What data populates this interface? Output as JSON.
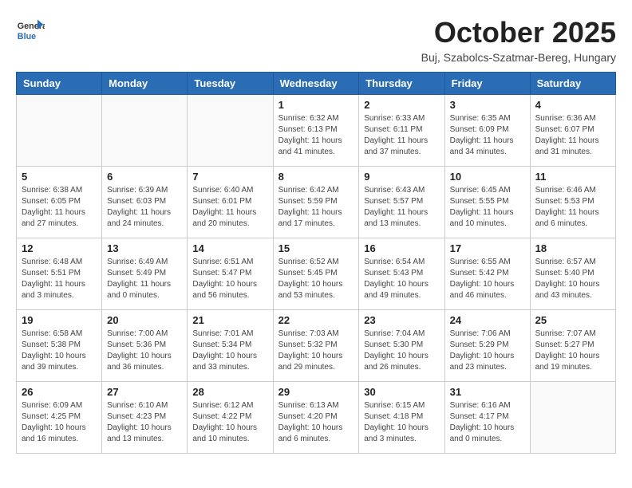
{
  "header": {
    "logo_line1": "General",
    "logo_line2": "Blue",
    "month": "October 2025",
    "location": "Buj, Szabolcs-Szatmar-Bereg, Hungary"
  },
  "weekdays": [
    "Sunday",
    "Monday",
    "Tuesday",
    "Wednesday",
    "Thursday",
    "Friday",
    "Saturday"
  ],
  "weeks": [
    [
      {
        "day": "",
        "info": ""
      },
      {
        "day": "",
        "info": ""
      },
      {
        "day": "",
        "info": ""
      },
      {
        "day": "1",
        "info": "Sunrise: 6:32 AM\nSunset: 6:13 PM\nDaylight: 11 hours\nand 41 minutes."
      },
      {
        "day": "2",
        "info": "Sunrise: 6:33 AM\nSunset: 6:11 PM\nDaylight: 11 hours\nand 37 minutes."
      },
      {
        "day": "3",
        "info": "Sunrise: 6:35 AM\nSunset: 6:09 PM\nDaylight: 11 hours\nand 34 minutes."
      },
      {
        "day": "4",
        "info": "Sunrise: 6:36 AM\nSunset: 6:07 PM\nDaylight: 11 hours\nand 31 minutes."
      }
    ],
    [
      {
        "day": "5",
        "info": "Sunrise: 6:38 AM\nSunset: 6:05 PM\nDaylight: 11 hours\nand 27 minutes."
      },
      {
        "day": "6",
        "info": "Sunrise: 6:39 AM\nSunset: 6:03 PM\nDaylight: 11 hours\nand 24 minutes."
      },
      {
        "day": "7",
        "info": "Sunrise: 6:40 AM\nSunset: 6:01 PM\nDaylight: 11 hours\nand 20 minutes."
      },
      {
        "day": "8",
        "info": "Sunrise: 6:42 AM\nSunset: 5:59 PM\nDaylight: 11 hours\nand 17 minutes."
      },
      {
        "day": "9",
        "info": "Sunrise: 6:43 AM\nSunset: 5:57 PM\nDaylight: 11 hours\nand 13 minutes."
      },
      {
        "day": "10",
        "info": "Sunrise: 6:45 AM\nSunset: 5:55 PM\nDaylight: 11 hours\nand 10 minutes."
      },
      {
        "day": "11",
        "info": "Sunrise: 6:46 AM\nSunset: 5:53 PM\nDaylight: 11 hours\nand 6 minutes."
      }
    ],
    [
      {
        "day": "12",
        "info": "Sunrise: 6:48 AM\nSunset: 5:51 PM\nDaylight: 11 hours\nand 3 minutes."
      },
      {
        "day": "13",
        "info": "Sunrise: 6:49 AM\nSunset: 5:49 PM\nDaylight: 11 hours\nand 0 minutes."
      },
      {
        "day": "14",
        "info": "Sunrise: 6:51 AM\nSunset: 5:47 PM\nDaylight: 10 hours\nand 56 minutes."
      },
      {
        "day": "15",
        "info": "Sunrise: 6:52 AM\nSunset: 5:45 PM\nDaylight: 10 hours\nand 53 minutes."
      },
      {
        "day": "16",
        "info": "Sunrise: 6:54 AM\nSunset: 5:43 PM\nDaylight: 10 hours\nand 49 minutes."
      },
      {
        "day": "17",
        "info": "Sunrise: 6:55 AM\nSunset: 5:42 PM\nDaylight: 10 hours\nand 46 minutes."
      },
      {
        "day": "18",
        "info": "Sunrise: 6:57 AM\nSunset: 5:40 PM\nDaylight: 10 hours\nand 43 minutes."
      }
    ],
    [
      {
        "day": "19",
        "info": "Sunrise: 6:58 AM\nSunset: 5:38 PM\nDaylight: 10 hours\nand 39 minutes."
      },
      {
        "day": "20",
        "info": "Sunrise: 7:00 AM\nSunset: 5:36 PM\nDaylight: 10 hours\nand 36 minutes."
      },
      {
        "day": "21",
        "info": "Sunrise: 7:01 AM\nSunset: 5:34 PM\nDaylight: 10 hours\nand 33 minutes."
      },
      {
        "day": "22",
        "info": "Sunrise: 7:03 AM\nSunset: 5:32 PM\nDaylight: 10 hours\nand 29 minutes."
      },
      {
        "day": "23",
        "info": "Sunrise: 7:04 AM\nSunset: 5:30 PM\nDaylight: 10 hours\nand 26 minutes."
      },
      {
        "day": "24",
        "info": "Sunrise: 7:06 AM\nSunset: 5:29 PM\nDaylight: 10 hours\nand 23 minutes."
      },
      {
        "day": "25",
        "info": "Sunrise: 7:07 AM\nSunset: 5:27 PM\nDaylight: 10 hours\nand 19 minutes."
      }
    ],
    [
      {
        "day": "26",
        "info": "Sunrise: 6:09 AM\nSunset: 4:25 PM\nDaylight: 10 hours\nand 16 minutes."
      },
      {
        "day": "27",
        "info": "Sunrise: 6:10 AM\nSunset: 4:23 PM\nDaylight: 10 hours\nand 13 minutes."
      },
      {
        "day": "28",
        "info": "Sunrise: 6:12 AM\nSunset: 4:22 PM\nDaylight: 10 hours\nand 10 minutes."
      },
      {
        "day": "29",
        "info": "Sunrise: 6:13 AM\nSunset: 4:20 PM\nDaylight: 10 hours\nand 6 minutes."
      },
      {
        "day": "30",
        "info": "Sunrise: 6:15 AM\nSunset: 4:18 PM\nDaylight: 10 hours\nand 3 minutes."
      },
      {
        "day": "31",
        "info": "Sunrise: 6:16 AM\nSunset: 4:17 PM\nDaylight: 10 hours\nand 0 minutes."
      },
      {
        "day": "",
        "info": ""
      }
    ]
  ]
}
